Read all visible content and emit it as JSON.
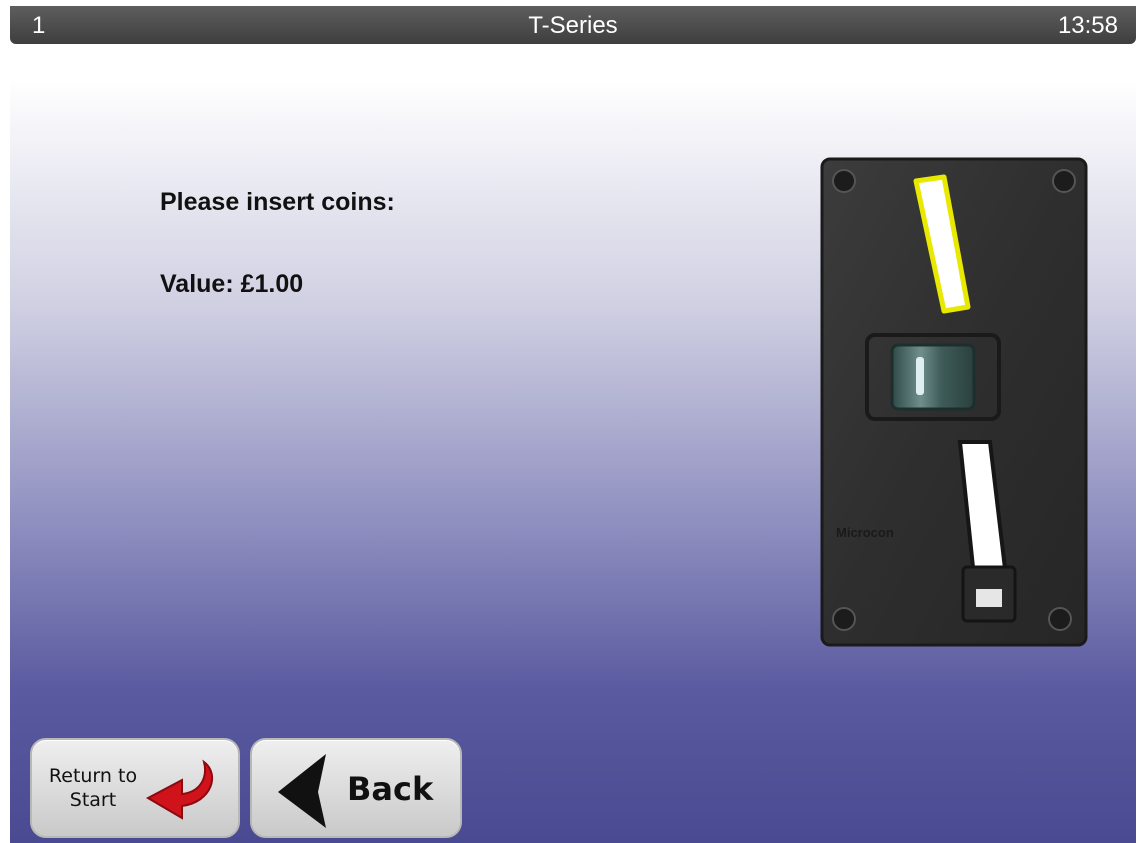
{
  "status_bar": {
    "left_text": "1",
    "title": "T-Series",
    "time": "13:58"
  },
  "main": {
    "prompt": "Please insert coins:",
    "value_text": "Value: £1.00",
    "coin_mech": {
      "brand": "Microcon",
      "icon": "coin-mechanism-image"
    }
  },
  "buttons": {
    "return_to_start": {
      "line1": "Return to",
      "line2": "Start",
      "icon": "red-curved-arrow-icon"
    },
    "back": {
      "label": "Back",
      "icon": "black-left-arrow-icon"
    }
  },
  "colors": {
    "status_bar": "#4a4a4a",
    "background_top": "#ffffff",
    "background_bottom": "#4a4a92",
    "slot_highlight": "#e8e800"
  }
}
